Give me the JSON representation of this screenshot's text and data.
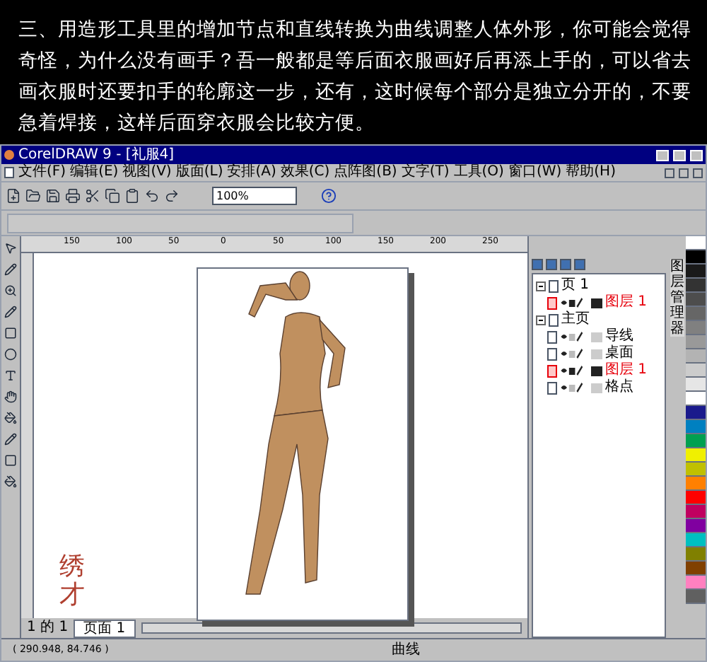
{
  "intro_text": [
    "三、用造形工具里的增加节点和直线转换为曲线调整人体外形，你可能会觉得",
    "奇怪，为什么没有画手？吾一般都是等后面衣服画好后再添上手的，可以省去",
    "画衣服时还要扣手的轮廓这一步，还有，这时候每个部分是独立分开的，不要",
    "急着焊接，这样后面穿衣服会比较方便。"
  ],
  "window": {
    "title": "CorelDRAW 9 - [礼服4]"
  },
  "menu": [
    "文件(F)",
    "编辑(E)",
    "视图(V)",
    "版面(L)",
    "安排(A)",
    "效果(C)",
    "点阵图(B)",
    "文字(T)",
    "工具(O)",
    "窗口(W)",
    "帮助(H)"
  ],
  "toolbar": {
    "zoom": "100%"
  },
  "ruler": [
    "150",
    "100",
    "50",
    "0",
    "50",
    "100",
    "150",
    "200",
    "250"
  ],
  "canvas": {
    "signature": "绣才"
  },
  "layers": {
    "tab": "图层管理器",
    "tree": [
      {
        "label": "页 1",
        "expanded": true,
        "children": [
          {
            "label": "图层 1",
            "active": true
          }
        ]
      },
      {
        "label": "主页",
        "expanded": true,
        "children": [
          {
            "label": "导线",
            "active": false
          },
          {
            "label": "桌面",
            "active": false
          },
          {
            "label": "图层 1",
            "active": true
          },
          {
            "label": "格点",
            "active": false
          }
        ]
      }
    ]
  },
  "page_nav": {
    "count": "1 的 1",
    "tab": "页面 1"
  },
  "status_bar": {
    "coords": "( 290.948, 84.746 )",
    "object": "曲线"
  }
}
